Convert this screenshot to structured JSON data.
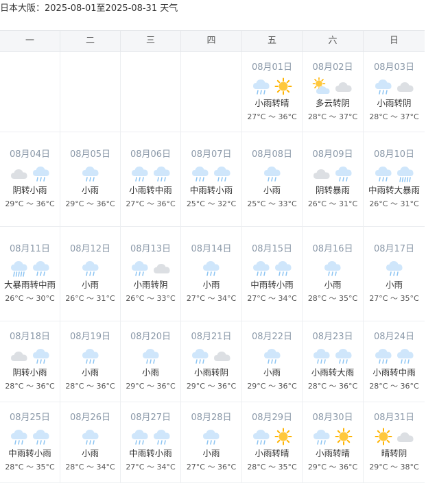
{
  "title": "日本大阪：2025-08-01至2025-08-31 天气",
  "weekdays": [
    "一",
    "二",
    "三",
    "四",
    "五",
    "六",
    "日"
  ],
  "weeks": [
    [
      null,
      null,
      null,
      null,
      {
        "date": "08月01日",
        "icons": [
          "rain-cloud-icon",
          "sun-icon"
        ],
        "desc": "小雨转晴",
        "temp": "27°C ～ 36°C"
      },
      {
        "date": "08月02日",
        "icons": [
          "partly-cloudy-icon",
          "cloud-icon"
        ],
        "desc": "多云转阴",
        "temp": "28°C ～ 37°C"
      },
      {
        "date": "08月03日",
        "icons": [
          "rain-cloud-icon",
          "cloud-icon"
        ],
        "desc": "小雨转阴",
        "temp": "28°C ～ 37°C"
      }
    ],
    [
      {
        "date": "08月04日",
        "icons": [
          "cloud-icon",
          "rain-cloud-icon"
        ],
        "desc": "阴转小雨",
        "temp": "29°C ～ 36°C"
      },
      {
        "date": "08月05日",
        "icons": [
          "rain-cloud-icon"
        ],
        "desc": "小雨",
        "temp": "29°C ～ 36°C"
      },
      {
        "date": "08月06日",
        "icons": [
          "rain-cloud-icon",
          "rain-cloud-icon"
        ],
        "desc": "小雨转中雨",
        "temp": "27°C ～ 36°C"
      },
      {
        "date": "08月07日",
        "icons": [
          "rain-cloud-icon",
          "rain-cloud-icon"
        ],
        "desc": "中雨转小雨",
        "temp": "25°C ～ 32°C"
      },
      {
        "date": "08月08日",
        "icons": [
          "rain-cloud-icon"
        ],
        "desc": "小雨",
        "temp": "25°C ～ 33°C"
      },
      {
        "date": "08月09日",
        "icons": [
          "cloud-icon",
          "rain-cloud-icon"
        ],
        "desc": "阴转暴雨",
        "temp": "26°C ～ 31°C"
      },
      {
        "date": "08月10日",
        "icons": [
          "rain-cloud-icon",
          "heavy-rain-cloud-icon"
        ],
        "desc": "中雨转大暴雨",
        "temp": "26°C ～ 31°C"
      }
    ],
    [
      {
        "date": "08月11日",
        "icons": [
          "heavy-rain-cloud-icon",
          "rain-cloud-icon"
        ],
        "desc": "大暴雨转中雨",
        "temp": "26°C ～ 30°C"
      },
      {
        "date": "08月12日",
        "icons": [
          "rain-cloud-icon"
        ],
        "desc": "小雨",
        "temp": "26°C ～ 31°C"
      },
      {
        "date": "08月13日",
        "icons": [
          "rain-cloud-icon",
          "cloud-icon"
        ],
        "desc": "小雨转阴",
        "temp": "26°C ～ 33°C"
      },
      {
        "date": "08月14日",
        "icons": [
          "rain-cloud-icon"
        ],
        "desc": "小雨",
        "temp": "27°C ～ 34°C"
      },
      {
        "date": "08月15日",
        "icons": [
          "rain-cloud-icon",
          "rain-cloud-icon"
        ],
        "desc": "中雨转小雨",
        "temp": "27°C ～ 34°C"
      },
      {
        "date": "08月16日",
        "icons": [
          "rain-cloud-icon"
        ],
        "desc": "小雨",
        "temp": "28°C ～ 35°C"
      },
      {
        "date": "08月17日",
        "icons": [
          "rain-cloud-icon"
        ],
        "desc": "小雨",
        "temp": "27°C ～ 35°C"
      }
    ],
    [
      {
        "date": "08月18日",
        "icons": [
          "cloud-icon",
          "rain-cloud-icon"
        ],
        "desc": "阴转小雨",
        "temp": "28°C ～ 36°C"
      },
      {
        "date": "08月19日",
        "icons": [
          "rain-cloud-icon"
        ],
        "desc": "小雨",
        "temp": "28°C ～ 36°C"
      },
      {
        "date": "08月20日",
        "icons": [
          "rain-cloud-icon"
        ],
        "desc": "小雨",
        "temp": "29°C ～ 36°C"
      },
      {
        "date": "08月21日",
        "icons": [
          "rain-cloud-icon",
          "cloud-icon"
        ],
        "desc": "小雨转阴",
        "temp": "29°C ～ 36°C"
      },
      {
        "date": "08月22日",
        "icons": [
          "rain-cloud-icon"
        ],
        "desc": "小雨",
        "temp": "29°C ～ 36°C"
      },
      {
        "date": "08月23日",
        "icons": [
          "rain-cloud-icon",
          "rain-cloud-icon"
        ],
        "desc": "小雨转大雨",
        "temp": "28°C ～ 36°C"
      },
      {
        "date": "08月24日",
        "icons": [
          "rain-cloud-icon",
          "rain-cloud-icon"
        ],
        "desc": "小雨转中雨",
        "temp": "28°C ～ 36°C"
      }
    ],
    [
      {
        "date": "08月25日",
        "icons": [
          "rain-cloud-icon",
          "rain-cloud-icon"
        ],
        "desc": "中雨转小雨",
        "temp": "28°C ～ 35°C"
      },
      {
        "date": "08月26日",
        "icons": [
          "rain-cloud-icon"
        ],
        "desc": "小雨",
        "temp": "28°C ～ 34°C"
      },
      {
        "date": "08月27日",
        "icons": [
          "rain-cloud-icon",
          "rain-cloud-icon"
        ],
        "desc": "中雨转小雨",
        "temp": "27°C ～ 34°C"
      },
      {
        "date": "08月28日",
        "icons": [
          "rain-cloud-icon"
        ],
        "desc": "小雨",
        "temp": "27°C ～ 36°C"
      },
      {
        "date": "08月29日",
        "icons": [
          "rain-cloud-icon",
          "sun-icon"
        ],
        "desc": "小雨转晴",
        "temp": "28°C ～ 35°C"
      },
      {
        "date": "08月30日",
        "icons": [
          "rain-cloud-icon",
          "sun-icon"
        ],
        "desc": "小雨转晴",
        "temp": "29°C ～ 36°C"
      },
      {
        "date": "08月31日",
        "icons": [
          "sun-icon",
          "cloud-icon"
        ],
        "desc": "晴转阴",
        "temp": "29°C ～ 38°C"
      }
    ]
  ],
  "colors": {
    "rain_cloud": "#cfe6fb",
    "rain_drop": "#8cc4f2",
    "cloud": "#dcdfe3",
    "sun": "#ffc83d",
    "sun_ray": "#ffb300",
    "date_text": "#8a98a8"
  }
}
